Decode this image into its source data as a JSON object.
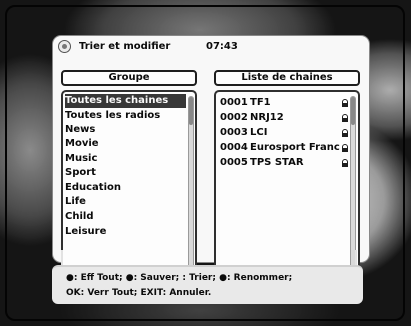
{
  "window": {
    "title": "Trier et modifier",
    "time": "07:43"
  },
  "left_pane": {
    "header": "Groupe",
    "items": [
      "Toutes les chaines",
      "Toutes les radios",
      "News",
      "Movie",
      "Music",
      "Sport",
      "Education",
      "Life",
      "Child",
      "Leisure"
    ],
    "selected_index": 0
  },
  "right_pane": {
    "header": "Liste de chaines",
    "channels": [
      {
        "number": "0001",
        "name": "TF1",
        "icon": "lock-icon"
      },
      {
        "number": "0002",
        "name": "NRJ12",
        "icon": "lock-icon"
      },
      {
        "number": "0003",
        "name": "LCI",
        "icon": "lock-icon"
      },
      {
        "number": "0004",
        "name": "Eurosport Franc",
        "icon": "lock-icon"
      },
      {
        "number": "0005",
        "name": "TPS STAR",
        "icon": "lock-icon"
      }
    ]
  },
  "footer": {
    "line1": "●: Eff Tout;  ●: Sauver;    : Trier;  ●: Renommer;",
    "line2": "OK: Verr Tout; EXIT: Annuler."
  }
}
